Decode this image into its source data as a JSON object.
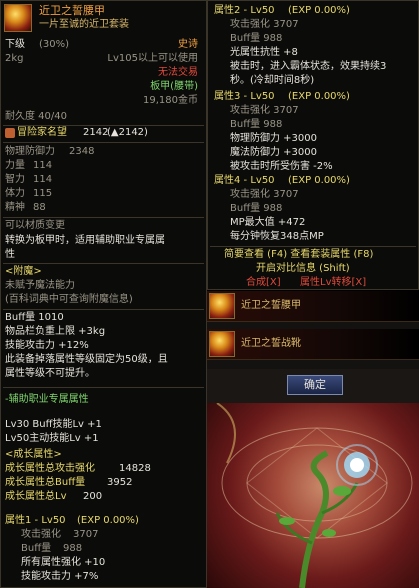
{
  "left_tooltip": {
    "item_name": "近卫之誓腰甲",
    "subtitle": "一片至诚的近卫套装",
    "slot": "下级",
    "slot_pct": "(30%)",
    "rarity": "史诗",
    "weight": "2kg",
    "level_req": "Lv105以上可以使用",
    "no_trade": "无法交易",
    "type": "板甲(腰带)",
    "price": "19,180金币",
    "durability": "耐久度 40/40",
    "fame_label": "冒险家名望",
    "fame_value": "2142",
    "fame_up": "(▲2142)",
    "stats": [
      {
        "name": "物理防御力",
        "value": "2348"
      },
      {
        "name": "力量",
        "value": "114"
      },
      {
        "name": "智力",
        "value": "114"
      },
      {
        "name": "体力",
        "value": "115"
      },
      {
        "name": "精神",
        "value": "88"
      }
    ],
    "material_change": "可以材质变更",
    "material_desc1": "转换为板甲时，适用辅助职业专属属",
    "material_desc2": "性",
    "enchant_header": "<附魔>",
    "enchant_none": "未赋予魔法能力",
    "enchant_ref": "(百科词典中可查询附魔信息)",
    "buff_line": "Buff量 1010",
    "inv_cap": "物品栏负重上限 +3kg",
    "skill_atk": "技能攻击力 +12%",
    "fixed_desc1": "此装备掉落属性等级固定为50级，且",
    "fixed_desc2": "属性等级不可提升。",
    "support_header": "-辅助职业专属属性",
    "support_1": "Lv30 Buff技能Lv +1",
    "support_2": "Lv50主动技能Lv +1",
    "growth_header": "<成长属性>",
    "growth_1_label": "成长属性总攻击强化",
    "growth_1_value": "14828",
    "growth_2_label": "成长属性总Buff量",
    "growth_2_value": "3952",
    "growth_3_label": "成长属性总Lv",
    "growth_3_value": "200",
    "attr1_header": "属性1 - Lv50",
    "attr1_exp": "(EXP 0.00%)",
    "attr1_atk_label": "攻击强化",
    "attr1_atk": "3707",
    "attr1_buff_label": "Buff量",
    "attr1_buff": "988",
    "attr1_all": "所有属性强化 +10",
    "attr1_skill": "技能攻击力 +7%"
  },
  "right_tooltip": {
    "attr2_header": "属性2 - Lv50",
    "attr2_exp": "(EXP 0.00%)",
    "attr2_atk": "攻击强化 3707",
    "attr2_buff": "Buff量 988",
    "attr2_light": "光属性抗性 +8",
    "attr2_desc1": "被击时，进入霸体状态，效果持续3",
    "attr2_desc2": "秒。(冷却时间8秒)",
    "attr3_header": "属性3 - Lv50",
    "attr3_exp": "(EXP 0.00%)",
    "attr3_atk": "攻击强化 3707",
    "attr3_buff": "Buff量 988",
    "attr3_phys": "物理防御力 +3000",
    "attr3_mag": "魔法防御力 +3000",
    "attr3_dmg": "被攻击时所受伤害 -2%",
    "attr4_header": "属性4 - Lv50",
    "attr4_exp": "(EXP 0.00%)",
    "attr4_atk": "攻击强化 3707",
    "attr4_buff": "Buff量 988",
    "attr4_mp": "MP最大值 +472",
    "attr4_mp_regen": "每分钟恢复348点MP",
    "set_info": "简要查看 (F4) 查看套装属性 (F8)",
    "compare": "开启对比信息 (Shift)",
    "synth": "合成[X]",
    "transfer": "属性Lv转移[X]"
  },
  "set_items": [
    {
      "name": "近卫之誓腰甲"
    },
    {
      "name": "近卫之誓战靴"
    }
  ],
  "confirm_button": "确定"
}
